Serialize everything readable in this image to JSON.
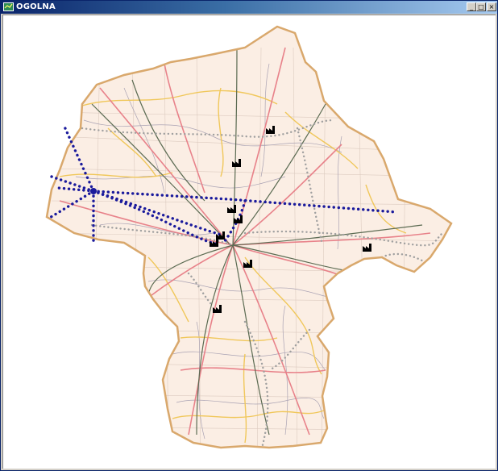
{
  "window": {
    "title": "OGOLNA",
    "icon": "map-window-icon",
    "controls": [
      {
        "name": "minimize-button",
        "glyph": "_"
      },
      {
        "name": "maximize-button",
        "glyph": "□"
      },
      {
        "name": "close-button",
        "glyph": "×"
      }
    ]
  },
  "map": {
    "region_fill": "#fbeee4",
    "border_color": "#d9a86c",
    "road_colors": {
      "main": "#e8828a",
      "secondary": "#f0c75a",
      "rail": "#5b6b52",
      "minor": "#9a9aa8"
    },
    "route_color": "#1a1a9c",
    "dotted_gray": "#a0a0a0",
    "markers": [
      "factory-icon",
      "factory-icon",
      "factory-icon",
      "factory-icon",
      "factory-icon",
      "factory-icon",
      "factory-icon",
      "factory-icon",
      "factory-icon"
    ]
  }
}
